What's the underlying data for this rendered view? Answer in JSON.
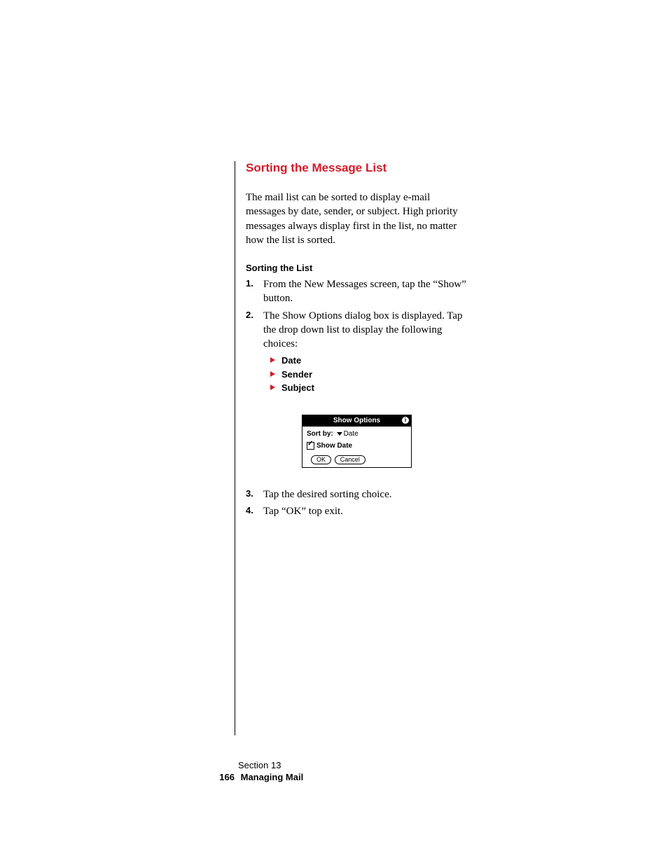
{
  "heading": "Sorting the Message List",
  "intro": "The mail list can be sorted to display e-mail messages by date, sender, or subject. High priority messages always display first in the list, no matter how the list is sorted.",
  "subhead": "Sorting the List",
  "steps_a": {
    "s1": {
      "num": "1.",
      "text": "From the New Messages screen, tap the “Show” button."
    },
    "s2": {
      "num": "2.",
      "text": "The Show Options dialog box is displayed. Tap the drop down list to display the following choices:"
    }
  },
  "bullets": {
    "b1": "Date",
    "b2": "Sender",
    "b3": "Subject"
  },
  "dialog": {
    "title": "Show Options",
    "info": "i",
    "sort_label": "Sort by:",
    "sort_value": "Date",
    "show_date": "Show Date",
    "ok": "OK",
    "cancel": "Cancel"
  },
  "steps_b": {
    "s3": {
      "num": "3.",
      "text": "Tap the desired sorting choice."
    },
    "s4": {
      "num": "4.",
      "text": "Tap “OK” top exit."
    }
  },
  "footer": {
    "section": "Section 13",
    "page": "166",
    "chapter": "Managing Mail"
  }
}
